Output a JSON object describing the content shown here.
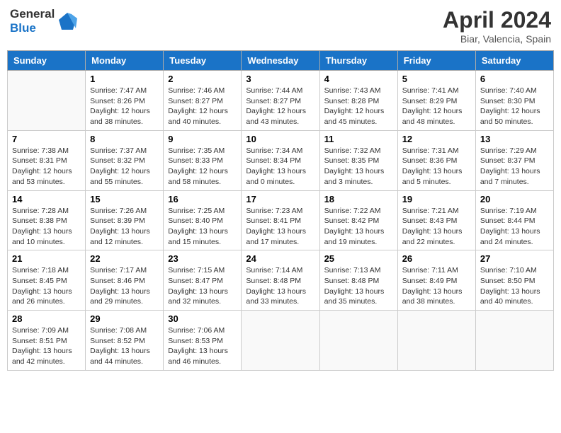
{
  "header": {
    "logo_line1": "General",
    "logo_line2": "Blue",
    "month_title": "April 2024",
    "location": "Biar, Valencia, Spain"
  },
  "weekdays": [
    "Sunday",
    "Monday",
    "Tuesday",
    "Wednesday",
    "Thursday",
    "Friday",
    "Saturday"
  ],
  "weeks": [
    [
      {
        "day": "",
        "sunrise": "",
        "sunset": "",
        "daylight": ""
      },
      {
        "day": "1",
        "sunrise": "7:47 AM",
        "sunset": "8:26 PM",
        "daylight": "12 hours and 38 minutes."
      },
      {
        "day": "2",
        "sunrise": "7:46 AM",
        "sunset": "8:27 PM",
        "daylight": "12 hours and 40 minutes."
      },
      {
        "day": "3",
        "sunrise": "7:44 AM",
        "sunset": "8:27 PM",
        "daylight": "12 hours and 43 minutes."
      },
      {
        "day": "4",
        "sunrise": "7:43 AM",
        "sunset": "8:28 PM",
        "daylight": "12 hours and 45 minutes."
      },
      {
        "day": "5",
        "sunrise": "7:41 AM",
        "sunset": "8:29 PM",
        "daylight": "12 hours and 48 minutes."
      },
      {
        "day": "6",
        "sunrise": "7:40 AM",
        "sunset": "8:30 PM",
        "daylight": "12 hours and 50 minutes."
      }
    ],
    [
      {
        "day": "7",
        "sunrise": "7:38 AM",
        "sunset": "8:31 PM",
        "daylight": "12 hours and 53 minutes."
      },
      {
        "day": "8",
        "sunrise": "7:37 AM",
        "sunset": "8:32 PM",
        "daylight": "12 hours and 55 minutes."
      },
      {
        "day": "9",
        "sunrise": "7:35 AM",
        "sunset": "8:33 PM",
        "daylight": "12 hours and 58 minutes."
      },
      {
        "day": "10",
        "sunrise": "7:34 AM",
        "sunset": "8:34 PM",
        "daylight": "13 hours and 0 minutes."
      },
      {
        "day": "11",
        "sunrise": "7:32 AM",
        "sunset": "8:35 PM",
        "daylight": "13 hours and 3 minutes."
      },
      {
        "day": "12",
        "sunrise": "7:31 AM",
        "sunset": "8:36 PM",
        "daylight": "13 hours and 5 minutes."
      },
      {
        "day": "13",
        "sunrise": "7:29 AM",
        "sunset": "8:37 PM",
        "daylight": "13 hours and 7 minutes."
      }
    ],
    [
      {
        "day": "14",
        "sunrise": "7:28 AM",
        "sunset": "8:38 PM",
        "daylight": "13 hours and 10 minutes."
      },
      {
        "day": "15",
        "sunrise": "7:26 AM",
        "sunset": "8:39 PM",
        "daylight": "13 hours and 12 minutes."
      },
      {
        "day": "16",
        "sunrise": "7:25 AM",
        "sunset": "8:40 PM",
        "daylight": "13 hours and 15 minutes."
      },
      {
        "day": "17",
        "sunrise": "7:23 AM",
        "sunset": "8:41 PM",
        "daylight": "13 hours and 17 minutes."
      },
      {
        "day": "18",
        "sunrise": "7:22 AM",
        "sunset": "8:42 PM",
        "daylight": "13 hours and 19 minutes."
      },
      {
        "day": "19",
        "sunrise": "7:21 AM",
        "sunset": "8:43 PM",
        "daylight": "13 hours and 22 minutes."
      },
      {
        "day": "20",
        "sunrise": "7:19 AM",
        "sunset": "8:44 PM",
        "daylight": "13 hours and 24 minutes."
      }
    ],
    [
      {
        "day": "21",
        "sunrise": "7:18 AM",
        "sunset": "8:45 PM",
        "daylight": "13 hours and 26 minutes."
      },
      {
        "day": "22",
        "sunrise": "7:17 AM",
        "sunset": "8:46 PM",
        "daylight": "13 hours and 29 minutes."
      },
      {
        "day": "23",
        "sunrise": "7:15 AM",
        "sunset": "8:47 PM",
        "daylight": "13 hours and 32 minutes."
      },
      {
        "day": "24",
        "sunrise": "7:14 AM",
        "sunset": "8:48 PM",
        "daylight": "13 hours and 33 minutes."
      },
      {
        "day": "25",
        "sunrise": "7:13 AM",
        "sunset": "8:48 PM",
        "daylight": "13 hours and 35 minutes."
      },
      {
        "day": "26",
        "sunrise": "7:11 AM",
        "sunset": "8:49 PM",
        "daylight": "13 hours and 38 minutes."
      },
      {
        "day": "27",
        "sunrise": "7:10 AM",
        "sunset": "8:50 PM",
        "daylight": "13 hours and 40 minutes."
      }
    ],
    [
      {
        "day": "28",
        "sunrise": "7:09 AM",
        "sunset": "8:51 PM",
        "daylight": "13 hours and 42 minutes."
      },
      {
        "day": "29",
        "sunrise": "7:08 AM",
        "sunset": "8:52 PM",
        "daylight": "13 hours and 44 minutes."
      },
      {
        "day": "30",
        "sunrise": "7:06 AM",
        "sunset": "8:53 PM",
        "daylight": "13 hours and 46 minutes."
      },
      {
        "day": "",
        "sunrise": "",
        "sunset": "",
        "daylight": ""
      },
      {
        "day": "",
        "sunrise": "",
        "sunset": "",
        "daylight": ""
      },
      {
        "day": "",
        "sunrise": "",
        "sunset": "",
        "daylight": ""
      },
      {
        "day": "",
        "sunrise": "",
        "sunset": "",
        "daylight": ""
      }
    ]
  ],
  "labels": {
    "sunrise_prefix": "Sunrise: ",
    "sunset_prefix": "Sunset: ",
    "daylight_prefix": "Daylight: "
  }
}
